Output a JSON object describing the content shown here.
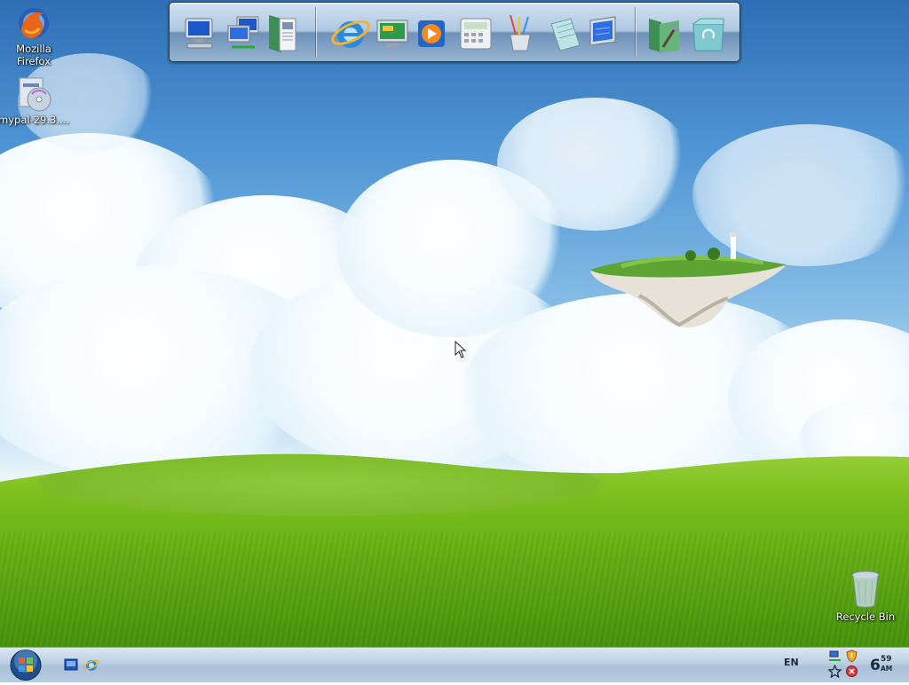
{
  "desktop": {
    "icons": [
      {
        "label": "Mozilla Firefox",
        "icon": "firefox-icon"
      },
      {
        "label": "mypal-29.3....",
        "icon": "installer-disc-icon"
      },
      {
        "label": "Recycle Bin",
        "icon": "recycle-bin-icon"
      }
    ]
  },
  "dock": {
    "items": [
      {
        "icon": "my-computer-icon"
      },
      {
        "icon": "network-icon"
      },
      {
        "icon": "documents-icon"
      },
      {
        "icon": "internet-explorer-icon"
      },
      {
        "icon": "control-panel-icon"
      },
      {
        "icon": "media-player-icon"
      },
      {
        "icon": "calculator-icon"
      },
      {
        "icon": "paint-icon"
      },
      {
        "icon": "notepad-icon"
      },
      {
        "icon": "display-settings-icon"
      },
      {
        "icon": "tools-folder-icon"
      },
      {
        "icon": "recycle-folder-icon"
      }
    ]
  },
  "taskbar": {
    "start": {
      "icon": "windows-orb-icon"
    },
    "quick_launch": [
      {
        "icon": "show-desktop-icon"
      },
      {
        "icon": "internet-explorer-icon"
      }
    ],
    "language": "EN",
    "tray": [
      {
        "icon": "network-tray-icon"
      },
      {
        "icon": "security-shield-icon"
      },
      {
        "icon": "star-tray-icon"
      },
      {
        "icon": "alert-tray-icon"
      }
    ],
    "clock": {
      "hour": "6",
      "minute": "59",
      "ampm": "AM"
    }
  }
}
